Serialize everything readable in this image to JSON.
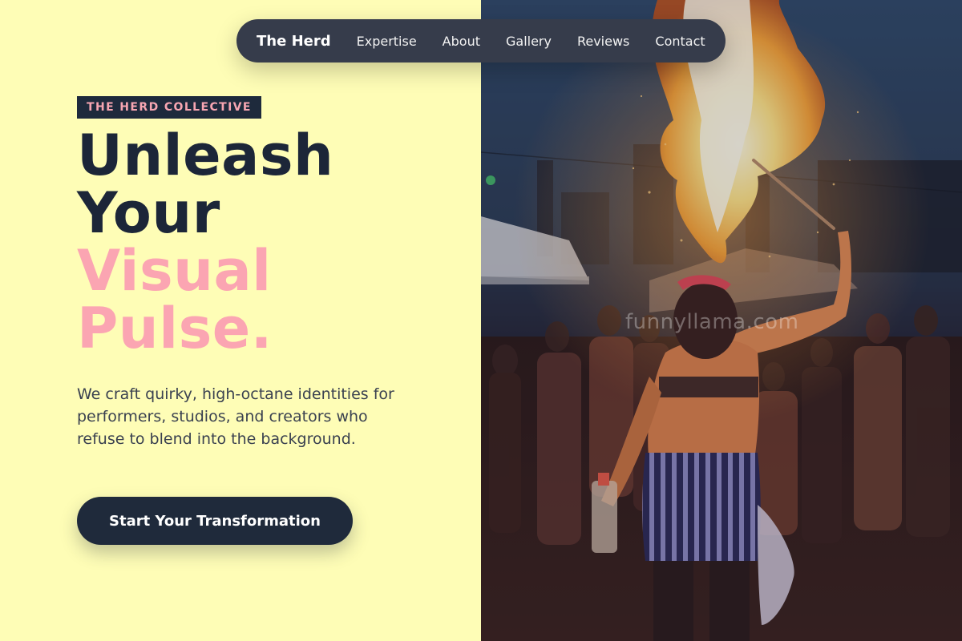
{
  "nav": {
    "brand": "The Herd",
    "links": [
      "Expertise",
      "About",
      "Gallery",
      "Reviews",
      "Contact"
    ]
  },
  "hero": {
    "eyebrow": "THE HERD COLLECTIVE",
    "headline_lines": [
      "Unleash",
      "Your"
    ],
    "headline_accent_lines": [
      "Visual",
      "Pulse."
    ],
    "subtext": "We craft quirky, high-octane identities for performers, studios, and creators who refuse to blend into the background.",
    "cta_label": "Start Your Transformation"
  },
  "image": {
    "watermark": "funnyllama.com"
  },
  "colors": {
    "background": "#fefdb6",
    "navy": "#1c2638",
    "accent_pink": "#fba5b2",
    "nav_bg": "#363c4b"
  }
}
